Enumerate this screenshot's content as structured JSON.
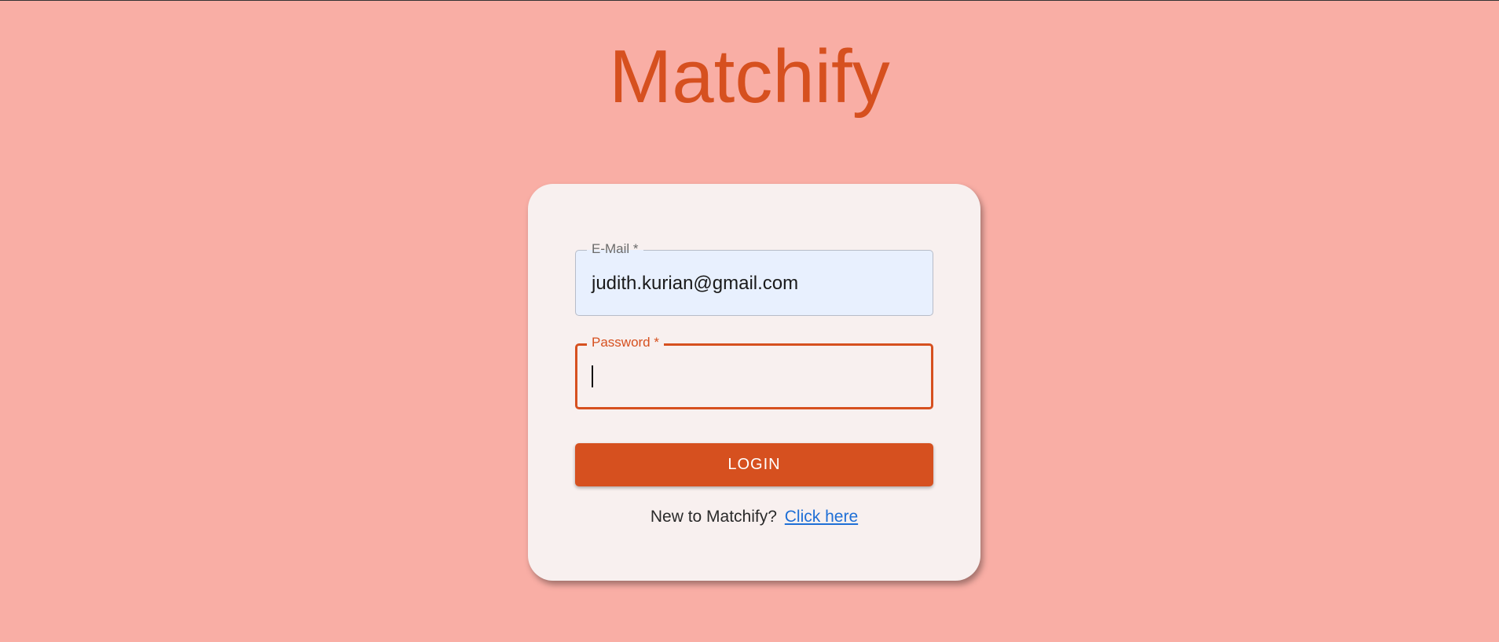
{
  "app": {
    "title": "Matchify"
  },
  "login_form": {
    "email": {
      "label": "E-Mail *",
      "value": "judith.kurian@gmail.com"
    },
    "password": {
      "label": "Password *",
      "value": ""
    },
    "login_button_label": "LOGIN",
    "signup_prompt": "New to Matchify?",
    "signup_link_label": "Click here"
  },
  "colors": {
    "background": "#f9aea5",
    "accent": "#d6501f",
    "card": "#f8f0ef",
    "autofill_field": "#e8f0fe",
    "link": "#1f6fd6"
  }
}
